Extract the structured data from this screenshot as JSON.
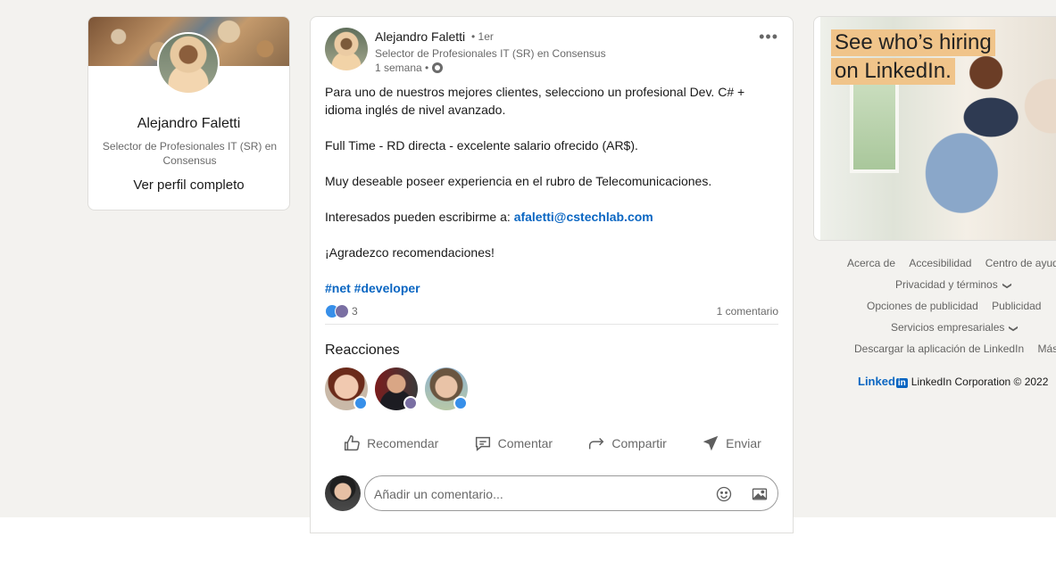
{
  "profile": {
    "name": "Alejandro Faletti",
    "headline": "Selector de Profesionales IT (SR) en Consensus",
    "view_profile": "Ver perfil completo"
  },
  "post": {
    "author_name": "Alejandro Faletti",
    "degree": "• 1er",
    "author_headline": "Selector de Profesionales IT (SR) en Consensus",
    "time": "1 semana •",
    "more_label": "•••",
    "body": {
      "line1": "Para uno de nuestros mejores clientes, selecciono un profesional Dev. C# + idioma inglés de nivel avanzado.",
      "line2": "Full Time - RD directa - excelente salario ofrecido (AR$).",
      "line3": "Muy deseable poseer experiencia en el rubro de Telecomunicaciones.",
      "line4_prefix": "Interesados pueden escribirme a: ",
      "email": "afaletti@cstechlab.com",
      "line5": "¡Agradezco recomendaciones!",
      "hashtags": "#net #developer"
    },
    "reaction_count": "3",
    "comments_count": "1 comentario",
    "reactions_title": "Reacciones",
    "actions": {
      "like": "Recomendar",
      "comment": "Comentar",
      "share": "Compartir",
      "send": "Enviar"
    },
    "comment_placeholder": "Añadir un comentario..."
  },
  "ad": {
    "line1": "See who’s hiring",
    "line2": "on LinkedIn."
  },
  "footer": {
    "row1": [
      "Acerca de",
      "Accesibilidad",
      "Centro de ayuda"
    ],
    "row2": "Privacidad y términos",
    "row3": [
      "Opciones de publicidad",
      "Publicidad"
    ],
    "row4": "Servicios empresariales",
    "row5": [
      "Descargar la aplicación de LinkedIn",
      "Más"
    ],
    "brand_text": "Linked",
    "brand_in": "in",
    "copyright": "LinkedIn Corporation © 2022"
  },
  "colors": {
    "accent": "#0a66c2",
    "page_bg": "#f3f2ef",
    "ad_highlight": "#f0c48a"
  }
}
